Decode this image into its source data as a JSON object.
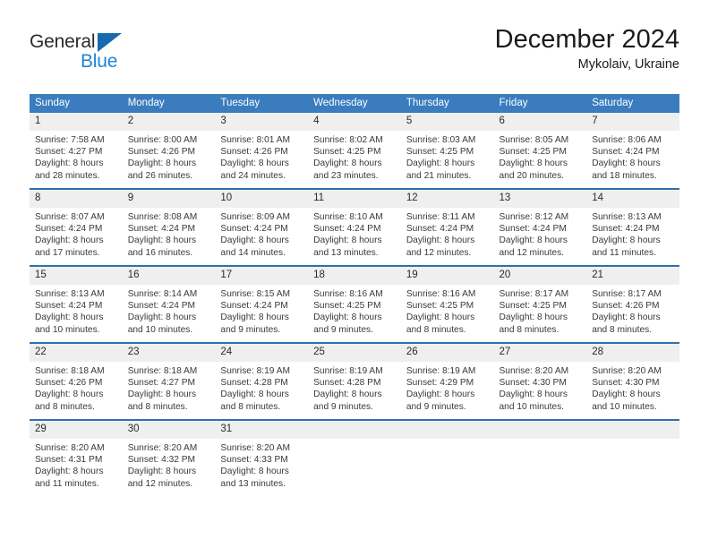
{
  "brand": {
    "line1": "General",
    "line2": "Blue",
    "logo_color": "#1769b0",
    "text_color": "#1f86d8"
  },
  "header": {
    "title": "December 2024",
    "subtitle": "Mykolaiv, Ukraine"
  },
  "theme": {
    "header_blue": "#3a7cbe",
    "separator_blue": "#2f6fab",
    "daynum_gray": "#efefef"
  },
  "weekday_headers": [
    "Sunday",
    "Monday",
    "Tuesday",
    "Wednesday",
    "Thursday",
    "Friday",
    "Saturday"
  ],
  "weeks": [
    [
      {
        "day": "1",
        "sunrise": "Sunrise: 7:58 AM",
        "sunset": "Sunset: 4:27 PM",
        "daylight1": "Daylight: 8 hours",
        "daylight2": "and 28 minutes."
      },
      {
        "day": "2",
        "sunrise": "Sunrise: 8:00 AM",
        "sunset": "Sunset: 4:26 PM",
        "daylight1": "Daylight: 8 hours",
        "daylight2": "and 26 minutes."
      },
      {
        "day": "3",
        "sunrise": "Sunrise: 8:01 AM",
        "sunset": "Sunset: 4:26 PM",
        "daylight1": "Daylight: 8 hours",
        "daylight2": "and 24 minutes."
      },
      {
        "day": "4",
        "sunrise": "Sunrise: 8:02 AM",
        "sunset": "Sunset: 4:25 PM",
        "daylight1": "Daylight: 8 hours",
        "daylight2": "and 23 minutes."
      },
      {
        "day": "5",
        "sunrise": "Sunrise: 8:03 AM",
        "sunset": "Sunset: 4:25 PM",
        "daylight1": "Daylight: 8 hours",
        "daylight2": "and 21 minutes."
      },
      {
        "day": "6",
        "sunrise": "Sunrise: 8:05 AM",
        "sunset": "Sunset: 4:25 PM",
        "daylight1": "Daylight: 8 hours",
        "daylight2": "and 20 minutes."
      },
      {
        "day": "7",
        "sunrise": "Sunrise: 8:06 AM",
        "sunset": "Sunset: 4:24 PM",
        "daylight1": "Daylight: 8 hours",
        "daylight2": "and 18 minutes."
      }
    ],
    [
      {
        "day": "8",
        "sunrise": "Sunrise: 8:07 AM",
        "sunset": "Sunset: 4:24 PM",
        "daylight1": "Daylight: 8 hours",
        "daylight2": "and 17 minutes."
      },
      {
        "day": "9",
        "sunrise": "Sunrise: 8:08 AM",
        "sunset": "Sunset: 4:24 PM",
        "daylight1": "Daylight: 8 hours",
        "daylight2": "and 16 minutes."
      },
      {
        "day": "10",
        "sunrise": "Sunrise: 8:09 AM",
        "sunset": "Sunset: 4:24 PM",
        "daylight1": "Daylight: 8 hours",
        "daylight2": "and 14 minutes."
      },
      {
        "day": "11",
        "sunrise": "Sunrise: 8:10 AM",
        "sunset": "Sunset: 4:24 PM",
        "daylight1": "Daylight: 8 hours",
        "daylight2": "and 13 minutes."
      },
      {
        "day": "12",
        "sunrise": "Sunrise: 8:11 AM",
        "sunset": "Sunset: 4:24 PM",
        "daylight1": "Daylight: 8 hours",
        "daylight2": "and 12 minutes."
      },
      {
        "day": "13",
        "sunrise": "Sunrise: 8:12 AM",
        "sunset": "Sunset: 4:24 PM",
        "daylight1": "Daylight: 8 hours",
        "daylight2": "and 12 minutes."
      },
      {
        "day": "14",
        "sunrise": "Sunrise: 8:13 AM",
        "sunset": "Sunset: 4:24 PM",
        "daylight1": "Daylight: 8 hours",
        "daylight2": "and 11 minutes."
      }
    ],
    [
      {
        "day": "15",
        "sunrise": "Sunrise: 8:13 AM",
        "sunset": "Sunset: 4:24 PM",
        "daylight1": "Daylight: 8 hours",
        "daylight2": "and 10 minutes."
      },
      {
        "day": "16",
        "sunrise": "Sunrise: 8:14 AM",
        "sunset": "Sunset: 4:24 PM",
        "daylight1": "Daylight: 8 hours",
        "daylight2": "and 10 minutes."
      },
      {
        "day": "17",
        "sunrise": "Sunrise: 8:15 AM",
        "sunset": "Sunset: 4:24 PM",
        "daylight1": "Daylight: 8 hours",
        "daylight2": "and 9 minutes."
      },
      {
        "day": "18",
        "sunrise": "Sunrise: 8:16 AM",
        "sunset": "Sunset: 4:25 PM",
        "daylight1": "Daylight: 8 hours",
        "daylight2": "and 9 minutes."
      },
      {
        "day": "19",
        "sunrise": "Sunrise: 8:16 AM",
        "sunset": "Sunset: 4:25 PM",
        "daylight1": "Daylight: 8 hours",
        "daylight2": "and 8 minutes."
      },
      {
        "day": "20",
        "sunrise": "Sunrise: 8:17 AM",
        "sunset": "Sunset: 4:25 PM",
        "daylight1": "Daylight: 8 hours",
        "daylight2": "and 8 minutes."
      },
      {
        "day": "21",
        "sunrise": "Sunrise: 8:17 AM",
        "sunset": "Sunset: 4:26 PM",
        "daylight1": "Daylight: 8 hours",
        "daylight2": "and 8 minutes."
      }
    ],
    [
      {
        "day": "22",
        "sunrise": "Sunrise: 8:18 AM",
        "sunset": "Sunset: 4:26 PM",
        "daylight1": "Daylight: 8 hours",
        "daylight2": "and 8 minutes."
      },
      {
        "day": "23",
        "sunrise": "Sunrise: 8:18 AM",
        "sunset": "Sunset: 4:27 PM",
        "daylight1": "Daylight: 8 hours",
        "daylight2": "and 8 minutes."
      },
      {
        "day": "24",
        "sunrise": "Sunrise: 8:19 AM",
        "sunset": "Sunset: 4:28 PM",
        "daylight1": "Daylight: 8 hours",
        "daylight2": "and 8 minutes."
      },
      {
        "day": "25",
        "sunrise": "Sunrise: 8:19 AM",
        "sunset": "Sunset: 4:28 PM",
        "daylight1": "Daylight: 8 hours",
        "daylight2": "and 9 minutes."
      },
      {
        "day": "26",
        "sunrise": "Sunrise: 8:19 AM",
        "sunset": "Sunset: 4:29 PM",
        "daylight1": "Daylight: 8 hours",
        "daylight2": "and 9 minutes."
      },
      {
        "day": "27",
        "sunrise": "Sunrise: 8:20 AM",
        "sunset": "Sunset: 4:30 PM",
        "daylight1": "Daylight: 8 hours",
        "daylight2": "and 10 minutes."
      },
      {
        "day": "28",
        "sunrise": "Sunrise: 8:20 AM",
        "sunset": "Sunset: 4:30 PM",
        "daylight1": "Daylight: 8 hours",
        "daylight2": "and 10 minutes."
      }
    ],
    [
      {
        "day": "29",
        "sunrise": "Sunrise: 8:20 AM",
        "sunset": "Sunset: 4:31 PM",
        "daylight1": "Daylight: 8 hours",
        "daylight2": "and 11 minutes."
      },
      {
        "day": "30",
        "sunrise": "Sunrise: 8:20 AM",
        "sunset": "Sunset: 4:32 PM",
        "daylight1": "Daylight: 8 hours",
        "daylight2": "and 12 minutes."
      },
      {
        "day": "31",
        "sunrise": "Sunrise: 8:20 AM",
        "sunset": "Sunset: 4:33 PM",
        "daylight1": "Daylight: 8 hours",
        "daylight2": "and 13 minutes."
      },
      {
        "day": "",
        "sunrise": "",
        "sunset": "",
        "daylight1": "",
        "daylight2": ""
      },
      {
        "day": "",
        "sunrise": "",
        "sunset": "",
        "daylight1": "",
        "daylight2": ""
      },
      {
        "day": "",
        "sunrise": "",
        "sunset": "",
        "daylight1": "",
        "daylight2": ""
      },
      {
        "day": "",
        "sunrise": "",
        "sunset": "",
        "daylight1": "",
        "daylight2": ""
      }
    ]
  ]
}
